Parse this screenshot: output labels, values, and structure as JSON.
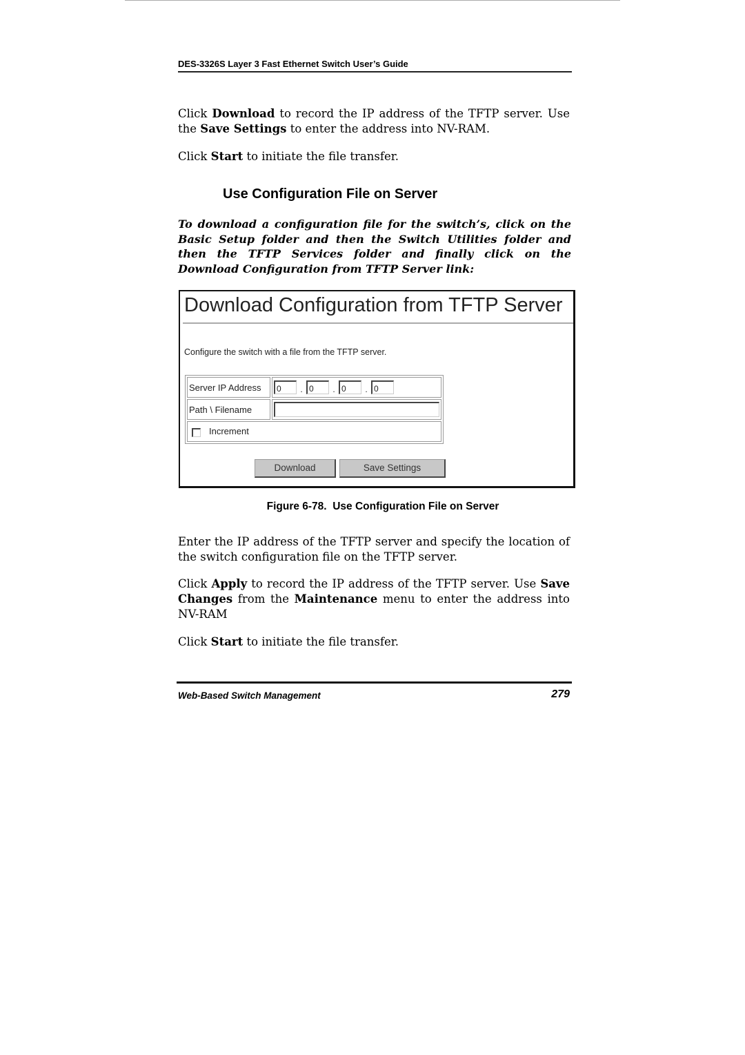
{
  "header": {
    "running_title": "DES-3326S Layer 3 Fast Ethernet Switch User’s Guide"
  },
  "intro_paragraphs": {
    "p1": {
      "t1": "Click ",
      "b1": "Download",
      "t2": " to record the IP address of the TFTP server. Use the ",
      "b2": "Save Settings",
      "t3": " to enter the address into NV-RAM."
    },
    "p2": {
      "t1": "Click ",
      "b1": "Start",
      "t2": " to initiate the file transfer."
    }
  },
  "section": {
    "title": "Use Configuration File on Server",
    "instruction": "To download a configuration file for the switch’s, click on the Basic Setup folder and then the Switch Utilities folder and then the TFTP Services folder and finally click on the Download Configuration from TFTP Server link:"
  },
  "screenshot": {
    "title": "Download Configuration from TFTP Server",
    "description": "Configure the switch with a file from the TFTP server.",
    "server_ip_label": "Server IP Address",
    "ip_octets": [
      "0",
      "0",
      "0",
      "0"
    ],
    "ip_separator": ".",
    "path_label": "Path \\ Filename",
    "path_value": "",
    "increment_label": "Increment",
    "increment_checked": false,
    "download_button": "Download",
    "save_settings_button": "Save Settings"
  },
  "figure_caption": {
    "number": "Figure 6-78.",
    "text": "Use Configuration File on Server"
  },
  "body_paragraphs": {
    "p3": "Enter the IP address of the TFTP server and specify the location of the switch configuration file on the TFTP server.",
    "p4": {
      "t1": "Click ",
      "b1": "Apply",
      "t2": " to record the IP address of the TFTP server. Use ",
      "b2": "Save Changes",
      "t3": " from the ",
      "b3": "Maintenance",
      "t4": " menu to enter the address into NV-RAM"
    },
    "p5": {
      "t1": "Click ",
      "b1": "Start",
      "t2": " to initiate the file transfer."
    }
  },
  "footer": {
    "section_name": "Web-Based Switch Management",
    "page_number": "279"
  }
}
